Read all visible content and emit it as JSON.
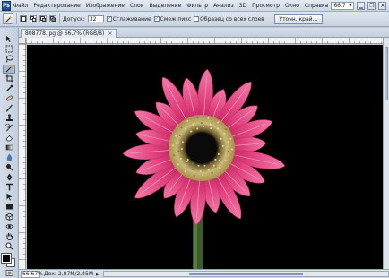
{
  "menubar": {
    "logo": "Ps",
    "items": [
      "Файл",
      "Редактирование",
      "Изображение",
      "Слои",
      "Выделение",
      "Фильтр",
      "Анализ",
      "3D",
      "Просмотр",
      "Окно",
      "Справка"
    ],
    "zoom": "66,7",
    "zoom_arrow": "▾"
  },
  "options": {
    "tolerance_label": "Допуск:",
    "tolerance_value": "32",
    "antialias_label": "Сглаживание",
    "contiguous_label": "Смеж.пикс",
    "sample_all_label": "Образец со всех слоев",
    "refine_edge_label": "Уточн. край..."
  },
  "document": {
    "tab_title": "808778.jpg @ 66,7% (RGB/8)",
    "close_glyph": "×"
  },
  "status": {
    "zoom": "66,67%",
    "doc_info": "Док: 2,87M/2,45M",
    "arrow": "▶"
  },
  "colors": {
    "petal": "#e0407c",
    "petal_light": "#f07aa8",
    "center_ring": "#b8a66a",
    "center_core": "#0a0a0a",
    "stem": "#3d5a2a"
  },
  "icons": {
    "menu_min": "▁",
    "menu_restore": "❐",
    "menu_close": "✕"
  }
}
